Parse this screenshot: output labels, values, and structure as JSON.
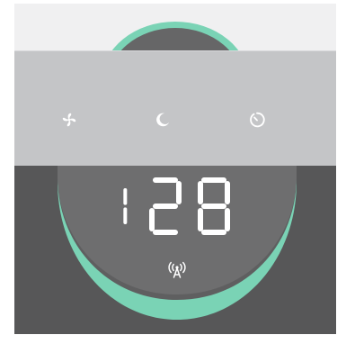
{
  "device": {
    "colors": {
      "accent": "#7ad3b5",
      "display_bg": "#6c6c6d",
      "dark_panel": "#575758",
      "button_bar": "#c4c5c7",
      "light_panel": "#f0f0f1",
      "icon_color": "#ffffff",
      "segment_color": "#ffffff"
    },
    "controls": [
      {
        "name": "fan",
        "icon": "fan-icon"
      },
      {
        "name": "sleep",
        "icon": "moon-icon"
      },
      {
        "name": "timer",
        "icon": "timer-icon"
      }
    ],
    "display": {
      "value": "128",
      "status_icon": "wireless-icon"
    }
  }
}
